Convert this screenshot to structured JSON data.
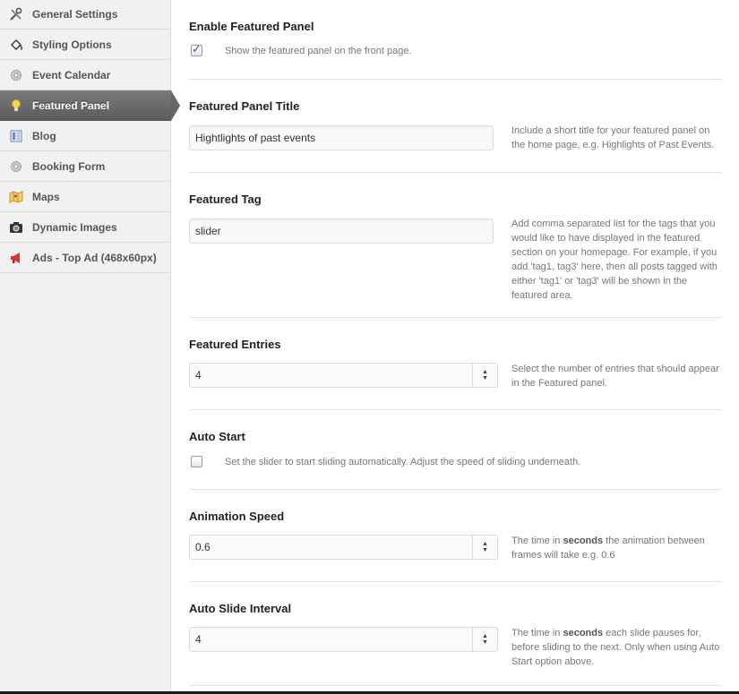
{
  "sidebar": {
    "items": [
      {
        "label": "General Settings",
        "icon": "tools-icon"
      },
      {
        "label": "Styling Options",
        "icon": "paint-bucket-icon"
      },
      {
        "label": "Event Calendar",
        "icon": "gear-icon"
      },
      {
        "label": "Featured Panel",
        "icon": "lightbulb-icon",
        "active": true
      },
      {
        "label": "Blog",
        "icon": "blog-icon"
      },
      {
        "label": "Booking Form",
        "icon": "gear-icon"
      },
      {
        "label": "Maps",
        "icon": "map-icon"
      },
      {
        "label": "Dynamic Images",
        "icon": "camera-icon"
      },
      {
        "label": "Ads - Top Ad (468x60px)",
        "icon": "megaphone-icon"
      }
    ]
  },
  "sections": {
    "enable": {
      "title": "Enable Featured Panel",
      "checked": true,
      "label": "Show the featured panel on the front page."
    },
    "panel_title": {
      "title": "Featured Panel Title",
      "value": "Hightlights of past events",
      "desc": "Include a short title for your featured panel on the home page, e.g. Highlights of Past Events."
    },
    "tag": {
      "title": "Featured Tag",
      "value": "slider",
      "desc": "Add comma separated list for the tags that you would like to have displayed in the featured section on your homepage. For example, if you add 'tag1, tag3' here, then all posts tagged with either 'tag1' or 'tag3' will be shown in the featured area."
    },
    "entries": {
      "title": "Featured Entries",
      "value": "4",
      "desc": "Select the number of entries that should appear in the Featured panel."
    },
    "auto_start": {
      "title": "Auto Start",
      "checked": false,
      "label": "Set the slider to start sliding automatically. Adjust the speed of sliding underneath."
    },
    "anim_speed": {
      "title": "Animation Speed",
      "value": "0.6",
      "desc_pre": "The time in ",
      "desc_bold": "seconds",
      "desc_post": " the animation between frames will take e.g. 0.6"
    },
    "interval": {
      "title": "Auto Slide Interval",
      "value": "4",
      "desc_pre": "The time in ",
      "desc_bold": "seconds",
      "desc_post": " each slide pauses for, before sliding to the next. Only when using Auto Start option above."
    }
  },
  "colors": {
    "active_nav": "#666666",
    "check_blue": "#2a5db0"
  }
}
